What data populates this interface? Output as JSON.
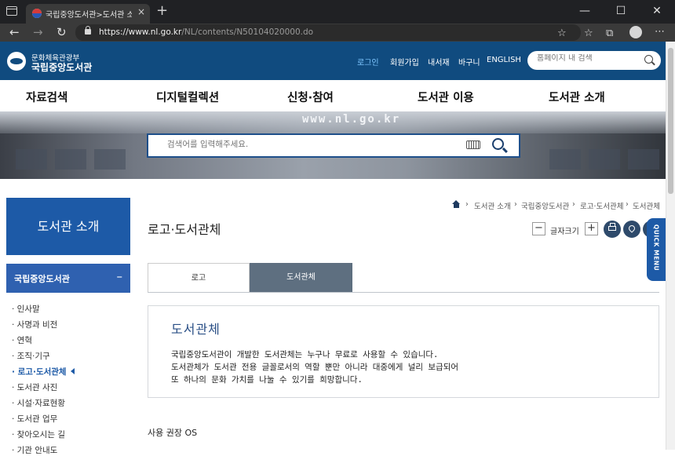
{
  "browser": {
    "tab_title": "국립중앙도서관>도서관 소개>로",
    "tab_close": "×",
    "new_tab": "+",
    "url_host": "https://www.nl.go.kr",
    "url_path": "/NL/contents/N50104020000.do",
    "minimize": "—",
    "maximize": "☐",
    "close": "✕"
  },
  "header": {
    "ministry": "문화체육관광부",
    "library_name": "국립중앙도서관",
    "links": [
      "로그인",
      "회원가입",
      "내서재",
      "바구니",
      "ENGLISH"
    ],
    "search_placeholder": "홈페이지 내 검색"
  },
  "gnb": [
    "자료검색",
    "디지털컬렉션",
    "신청·참여",
    "도서관 이용",
    "도서관 소개"
  ],
  "banner": {
    "site_text": "www.nl.go.kr",
    "search_placeholder": "검색어를 입력해주세요."
  },
  "sidebar": {
    "title": "도서관 소개",
    "section": "국립중앙도서관",
    "section_toggle": "–",
    "items": [
      "· 인사말",
      "· 사명과 비전",
      "· 연혁",
      "· 조직·기구",
      "· 로고·도서관체",
      "· 도서관 사진",
      "· 시설·자료현황",
      "· 도서관 업무",
      "· 찾아오시는 길",
      "· 기관 안내도"
    ]
  },
  "breadcrumb": [
    "도서관 소개",
    "국립중앙도서관",
    "로고·도서관체",
    "도서관체"
  ],
  "page": {
    "title": "로고·도서관체",
    "font_size_label": "글자크기",
    "font_minus": "−",
    "font_plus": "+",
    "quick_menu": "QUICK MENU"
  },
  "tabs": [
    "로고",
    "도서관체"
  ],
  "info": {
    "heading": "도서관체",
    "lines": [
      "국립중앙도서관이 개발한 도서관체는 누구나 무료로 사용할 수 있습니다.",
      "도서관체가 도서관 전용 글꼴로서의 역할 뿐만 아니라 대중에게 널리 보급되어",
      "또 하나의 문화 가치를 나눌 수 있기를 희망합니다."
    ]
  },
  "section_os": "사용 권장 OS"
}
